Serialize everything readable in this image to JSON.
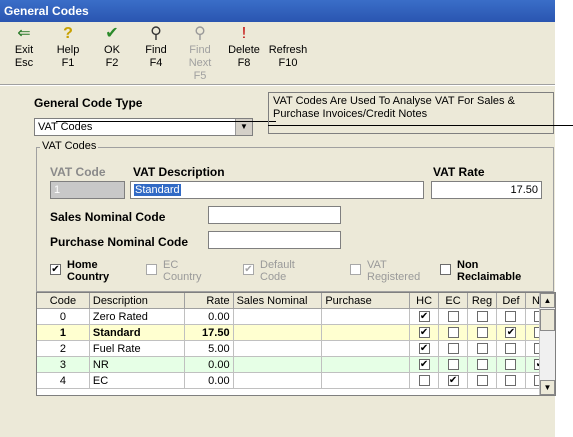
{
  "window": {
    "title": "General Codes"
  },
  "toolbar": [
    {
      "label": "Exit",
      "key": "Esc",
      "icon": "exit-icon",
      "glyph": "⇐",
      "disabled": false
    },
    {
      "label": "Help",
      "key": "F1",
      "icon": "help-icon",
      "glyph": "?",
      "disabled": false
    },
    {
      "label": "OK",
      "key": "F2",
      "icon": "ok-icon",
      "glyph": "✔",
      "disabled": false
    },
    {
      "label": "Find",
      "key": "F4",
      "icon": "find-icon",
      "glyph": "⚲",
      "disabled": false
    },
    {
      "label": "Find Next",
      "key": "F5",
      "icon": "find-next-icon",
      "glyph": "⚲",
      "disabled": true
    },
    {
      "label": "Delete",
      "key": "F8",
      "icon": "delete-icon",
      "glyph": "!",
      "disabled": false
    },
    {
      "label": "Refresh",
      "key": "F10",
      "icon": "refresh-icon",
      "glyph": "",
      "disabled": false
    }
  ],
  "code_type": {
    "label": "General Code Type",
    "selected": "VAT Codes",
    "info": "VAT Codes Are Used To Analyse VAT For Sales & Purchase Invoices/Credit Notes"
  },
  "vat": {
    "group_title": "VAT Codes",
    "code_label": "VAT Code",
    "code_value": "1",
    "desc_label": "VAT Description",
    "desc_value": "Standard",
    "rate_label": "VAT Rate",
    "rate_value": "17.50",
    "sales_label": "Sales Nominal Code",
    "sales_value": "",
    "purchase_label": "Purchase Nominal Code",
    "purchase_value": "",
    "flags": [
      {
        "l1": "Home",
        "l2": "Country",
        "checked": true,
        "disabled": false
      },
      {
        "l1": "EC",
        "l2": "Country",
        "checked": false,
        "disabled": true
      },
      {
        "l1": "Default",
        "l2": "Code",
        "checked": true,
        "disabled": true
      },
      {
        "l1": "VAT",
        "l2": "Registered",
        "checked": false,
        "disabled": true
      },
      {
        "l1": "Non",
        "l2": "Reclaimable",
        "checked": false,
        "disabled": false
      }
    ]
  },
  "table": {
    "headers": [
      "Code",
      "Description",
      "Rate",
      "Sales Nominal",
      "Purchase",
      "HC",
      "EC",
      "Reg",
      "Def",
      "NR"
    ],
    "rows": [
      {
        "code": "0",
        "desc": "Zero Rated",
        "rate": "0.00",
        "sales": "",
        "purchase": "",
        "hc": true,
        "ec": false,
        "reg": false,
        "def": false,
        "nr": false
      },
      {
        "code": "1",
        "desc": "Standard",
        "rate": "17.50",
        "sales": "",
        "purchase": "",
        "hc": true,
        "ec": false,
        "reg": false,
        "def": true,
        "nr": false
      },
      {
        "code": "2",
        "desc": "Fuel Rate",
        "rate": "5.00",
        "sales": "",
        "purchase": "",
        "hc": true,
        "ec": false,
        "reg": false,
        "def": false,
        "nr": false
      },
      {
        "code": "3",
        "desc": "NR",
        "rate": "0.00",
        "sales": "",
        "purchase": "",
        "hc": true,
        "ec": false,
        "reg": false,
        "def": false,
        "nr": true
      },
      {
        "code": "4",
        "desc": "EC",
        "rate": "0.00",
        "sales": "",
        "purchase": "",
        "hc": false,
        "ec": true,
        "reg": false,
        "def": false,
        "nr": false
      }
    ],
    "selected_index": 1
  }
}
